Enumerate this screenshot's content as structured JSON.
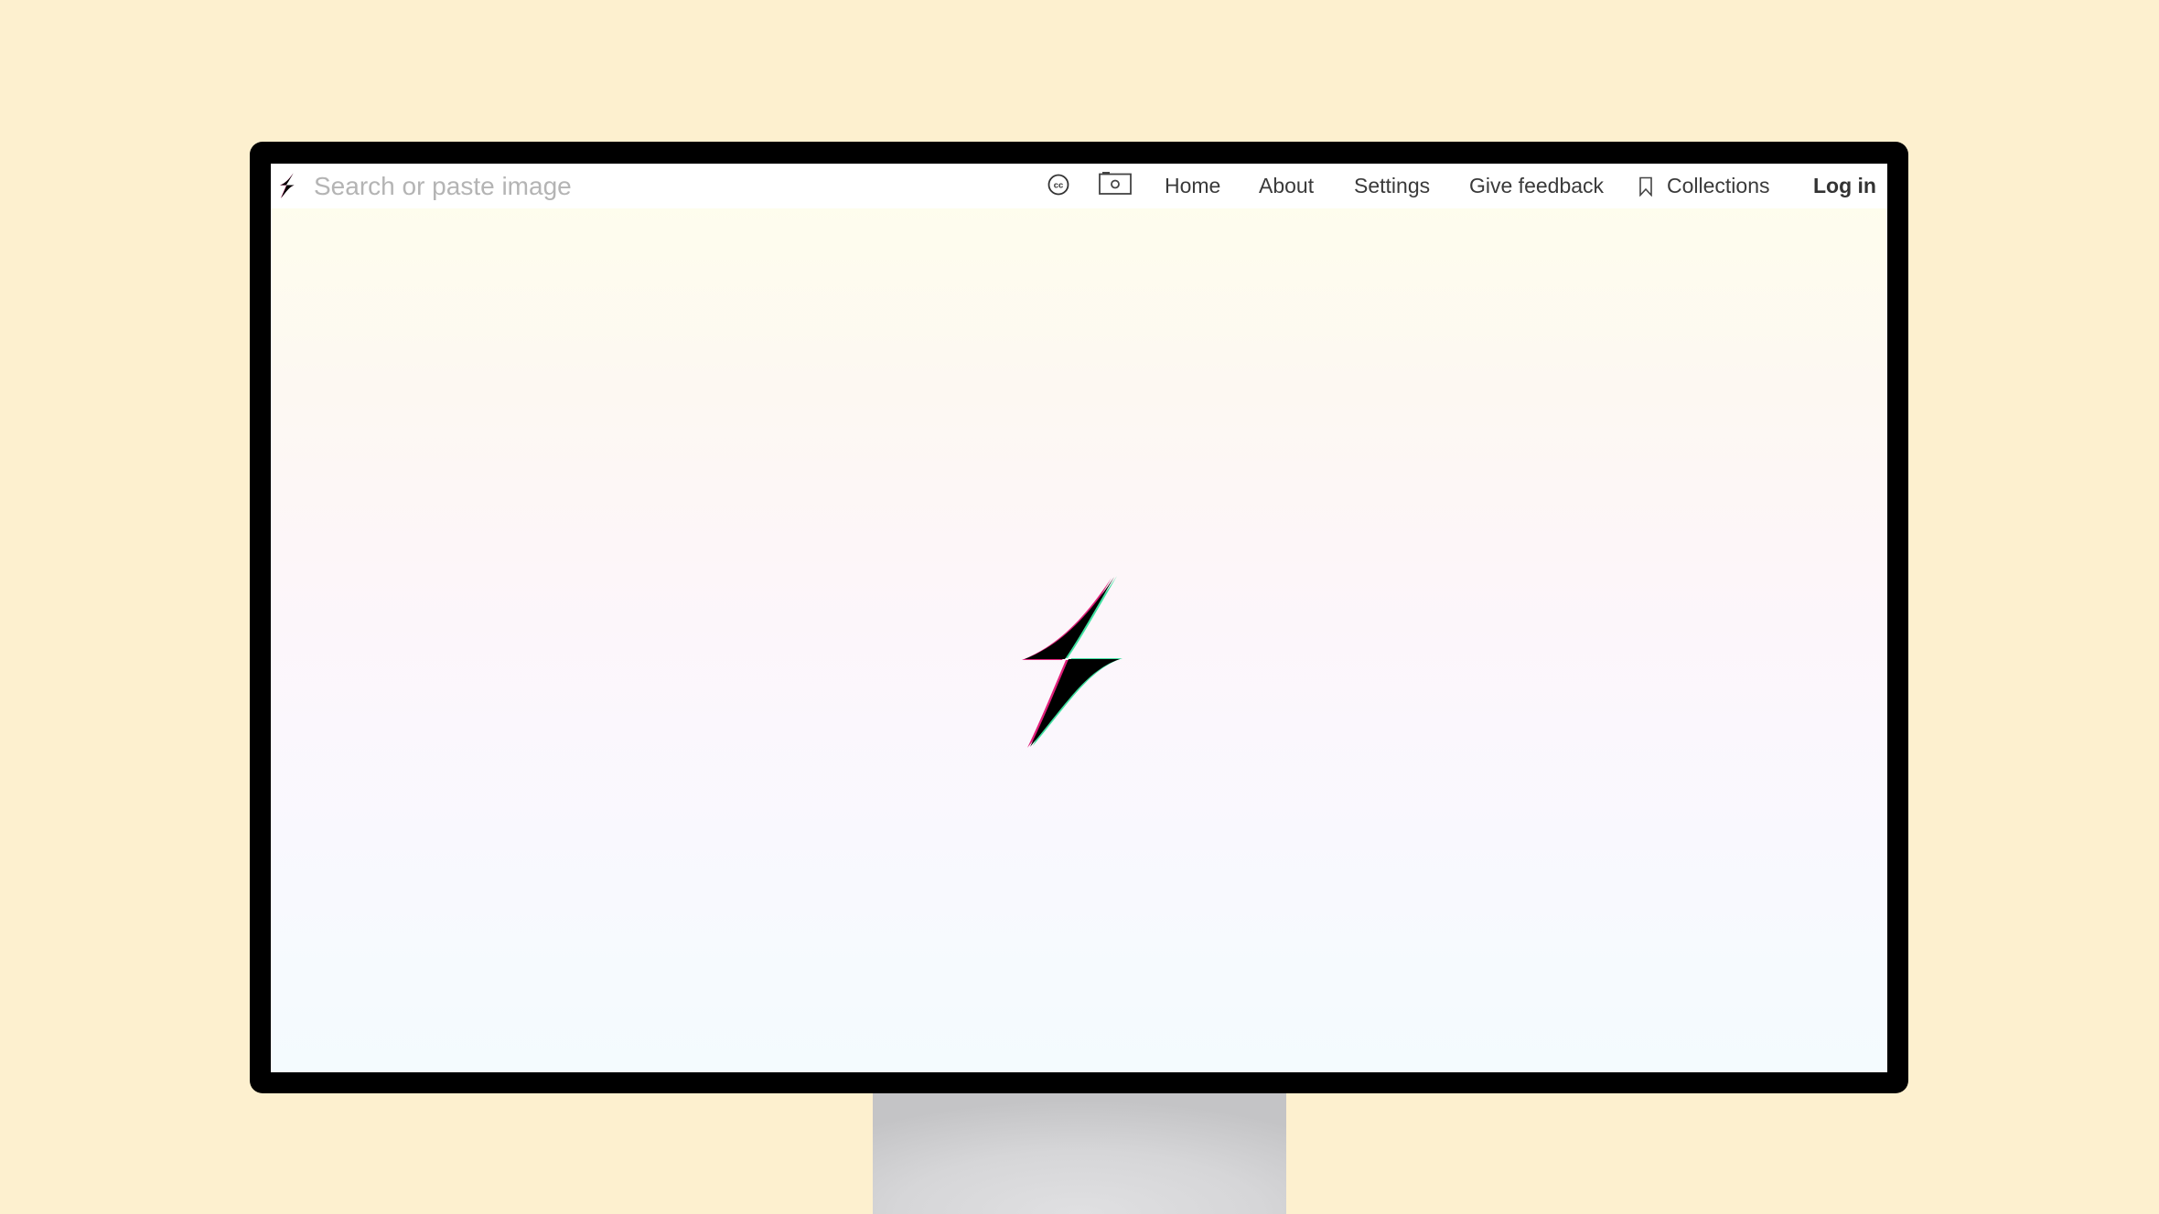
{
  "background": {
    "page_color": "#fdf0cf",
    "monitor_bezel_color": "#000000"
  },
  "header": {
    "logo_icon": "lightning-bolt-icon",
    "search": {
      "placeholder": "Search or paste image",
      "value": ""
    },
    "icons": [
      {
        "name": "creative-commons-icon",
        "label": "cc"
      },
      {
        "name": "camera-icon"
      }
    ],
    "nav": {
      "home": "Home",
      "about": "About",
      "settings": "Settings",
      "feedback": "Give feedback",
      "collections": "Collections",
      "login": "Log in"
    }
  },
  "main": {
    "hero_icon": "lightning-bolt-icon",
    "gradient_colors": [
      "#fefeec",
      "#fdf6f9",
      "#fbf7fd",
      "#f4fbfe"
    ]
  }
}
